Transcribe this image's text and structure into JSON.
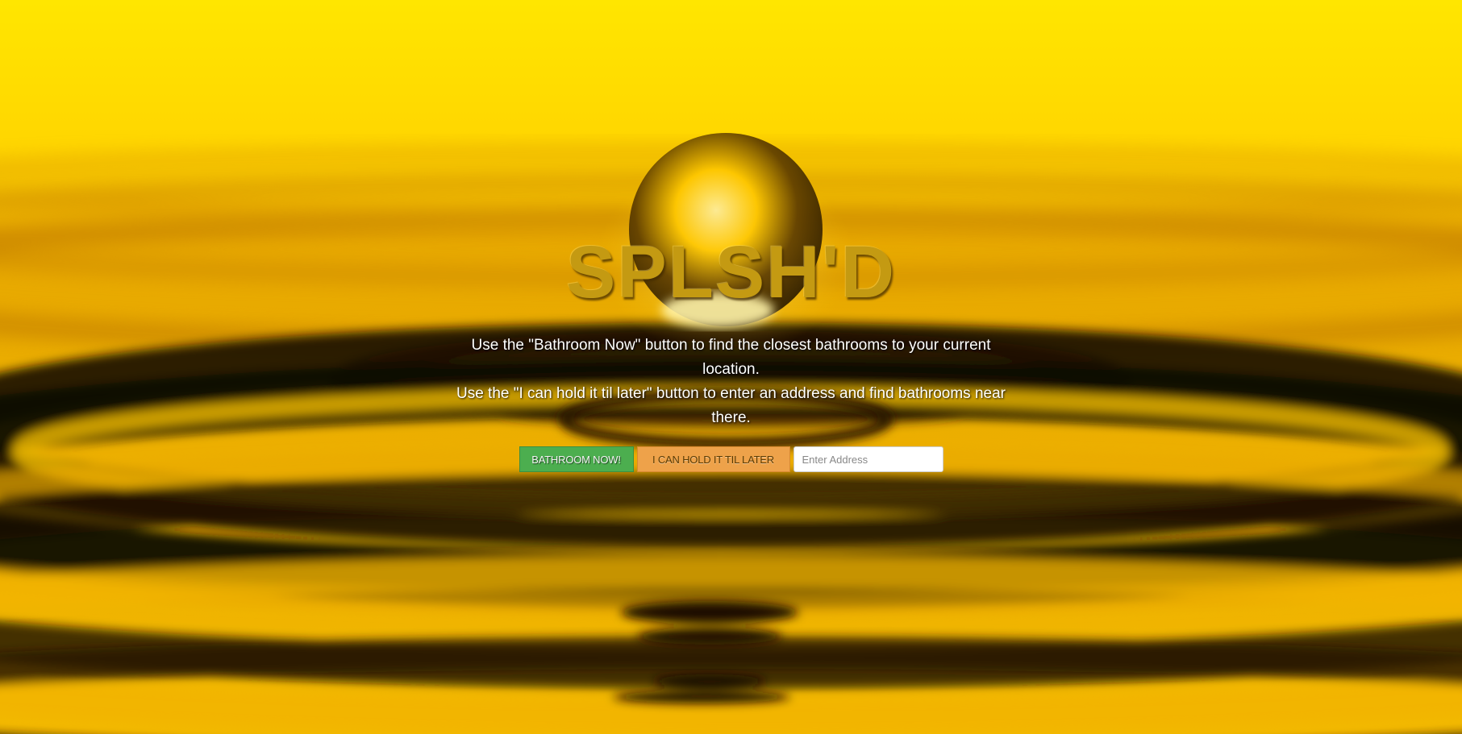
{
  "title": "SPLSH'D",
  "instructions": {
    "line1": "Use the \"Bathroom Now\" button to find the closest bathrooms to your current location.",
    "line2": "Use the \"I can hold it til later\" button to enter an address and find bathrooms near there."
  },
  "buttons": {
    "bathroom_now": "BATHROOM NOW!",
    "hold_later": "I CAN HOLD IT TIL LATER"
  },
  "address_input": {
    "placeholder": "Enter Address",
    "value": ""
  },
  "colors": {
    "background_yellow": "#ffd800",
    "dark_ripple": "#1a0e00",
    "title": "#c49a12",
    "bathroom_now_button": "#4cae4f",
    "hold_later_button": "#eea24a"
  }
}
